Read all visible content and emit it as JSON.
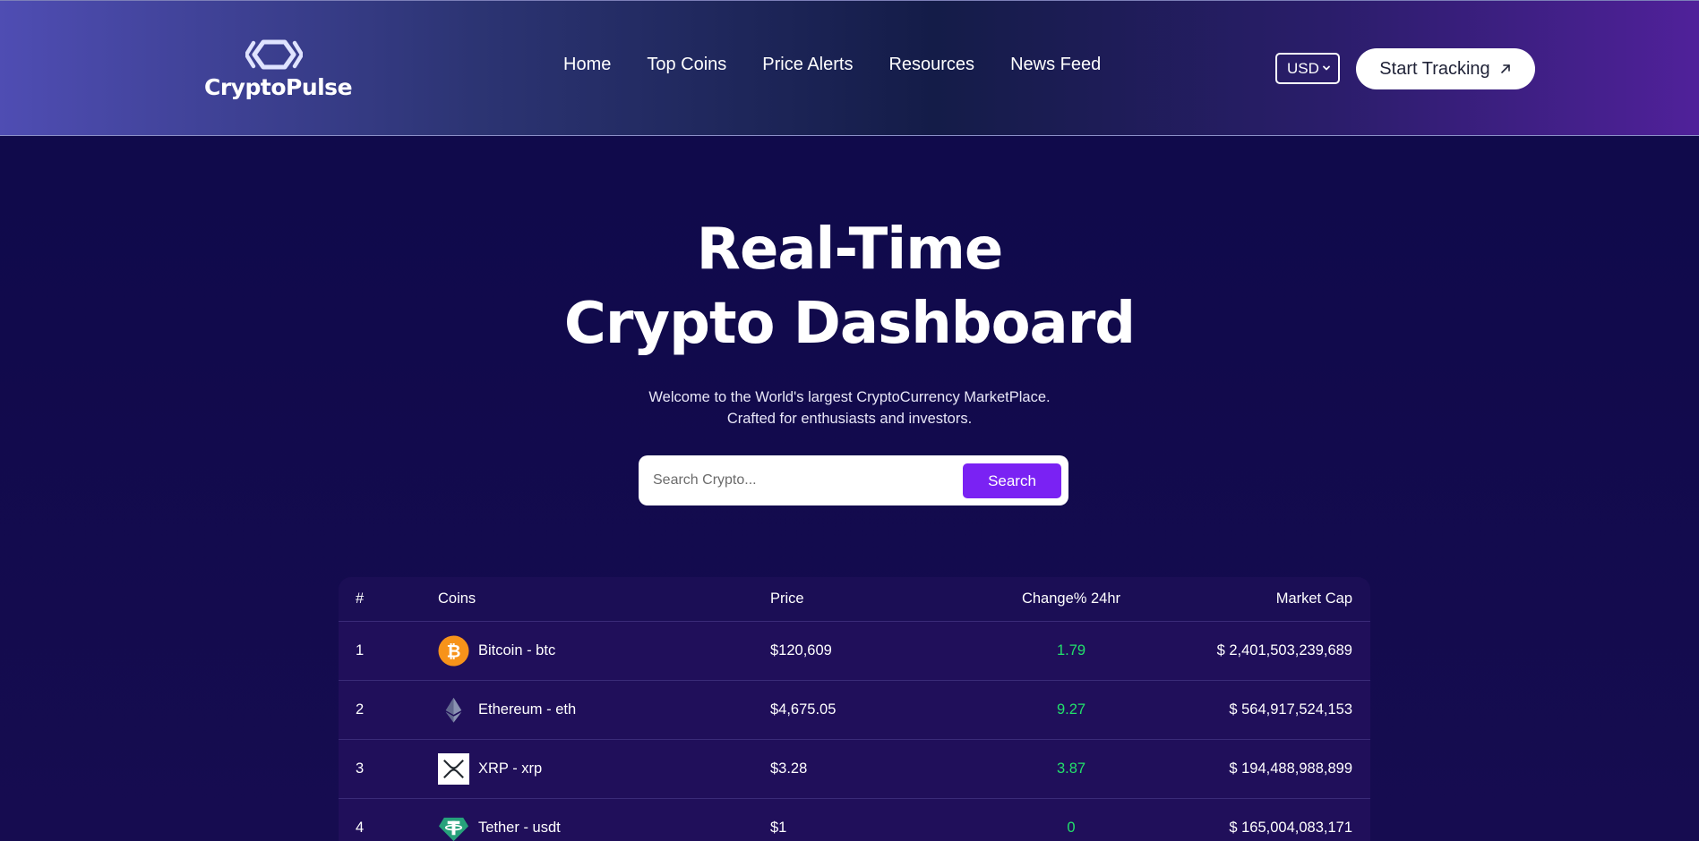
{
  "brand": {
    "name": "CryptoPulse",
    "logo_icon": "hexagon-chevrons-icon"
  },
  "nav": {
    "links": [
      "Home",
      "Top Coins",
      "Price Alerts",
      "Resources",
      "News Feed"
    ],
    "currency": "USD",
    "cta_label": "Start Tracking"
  },
  "hero": {
    "title_line1": "Real-Time",
    "title_line2": "Crypto Dashboard",
    "subtitle_line1": "Welcome to the World's largest CryptoCurrency MarketPlace.",
    "subtitle_line2": "Crafted for enthusiasts and investors."
  },
  "search": {
    "placeholder": "Search Crypto...",
    "button_label": "Search"
  },
  "table": {
    "headers": {
      "rank": "#",
      "coin": "Coins",
      "price": "Price",
      "change": "Change% 24hr",
      "cap": "Market Cap"
    },
    "rows": [
      {
        "rank": "1",
        "coin": "Bitcoin - btc",
        "price": "$120,609",
        "change": "1.79",
        "cap": "$ 2,401,503,239,689",
        "icon": "bitcoin-icon"
      },
      {
        "rank": "2",
        "coin": "Ethereum - eth",
        "price": "$4,675.05",
        "change": "9.27",
        "cap": "$ 564,917,524,153",
        "icon": "ethereum-icon"
      },
      {
        "rank": "3",
        "coin": "XRP - xrp",
        "price": "$3.28",
        "change": "3.87",
        "cap": "$ 194,488,988,899",
        "icon": "xrp-icon"
      },
      {
        "rank": "4",
        "coin": "Tether - usdt",
        "price": "$1",
        "change": "0",
        "cap": "$ 165,004,083,171",
        "icon": "tether-icon"
      }
    ]
  },
  "colors": {
    "accent": "#7a22f3",
    "positive": "#22e06b",
    "page_bg": "#110a4c",
    "table_bg": "#1b0e55"
  }
}
